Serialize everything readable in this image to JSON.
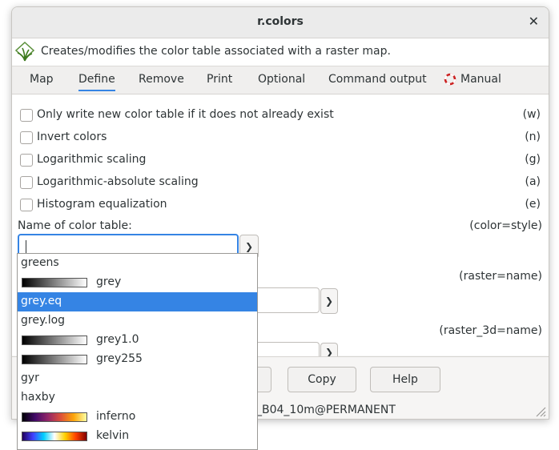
{
  "window": {
    "title": "r.colors"
  },
  "description": "Creates/modifies the color table associated with a raster map.",
  "tabs": [
    {
      "label": "Map"
    },
    {
      "label": "Define"
    },
    {
      "label": "Remove"
    },
    {
      "label": "Print"
    },
    {
      "label": "Optional"
    },
    {
      "label": "Command output"
    },
    {
      "label": "Manual"
    }
  ],
  "active_tab": "Define",
  "flags": [
    {
      "label": "Only write new color table if it does not already exist",
      "key": "(w)",
      "checked": false
    },
    {
      "label": "Invert colors",
      "key": "(n)",
      "checked": false
    },
    {
      "label": "Logarithmic scaling",
      "key": "(g)",
      "checked": false
    },
    {
      "label": "Logarithmic-absolute scaling",
      "key": "(a)",
      "checked": false
    },
    {
      "label": "Histogram equalization",
      "key": "(e)",
      "checked": false
    }
  ],
  "color_table": {
    "label": "Name of color table:",
    "key": "(color=style)",
    "value": ""
  },
  "raster": {
    "key": "(raster=name)"
  },
  "raster_3d": {
    "key": "(raster_3d=name)"
  },
  "buttons": {
    "copy": "Copy",
    "help": "Help"
  },
  "status_text": "_B04_10m@PERMANENT",
  "dropdown": {
    "items": [
      {
        "label": "greens",
        "swatch": null
      },
      {
        "label": "grey",
        "swatch": "linear-gradient(90deg,#000000,#ffffff)"
      },
      {
        "label": "grey.eq",
        "swatch": null,
        "selected": true
      },
      {
        "label": "grey.log",
        "swatch": null
      },
      {
        "label": "grey1.0",
        "swatch": "linear-gradient(90deg,#000000,#ffffff)"
      },
      {
        "label": "grey255",
        "swatch": "linear-gradient(90deg,#000000,#ffffff)"
      },
      {
        "label": "gyr",
        "swatch": null
      },
      {
        "label": "haxby",
        "swatch": null
      },
      {
        "label": "inferno",
        "swatch": "linear-gradient(90deg,#000004,#420a68,#932667,#dd513a,#fca50a,#fcffa4)"
      },
      {
        "label": "kelvin",
        "swatch": "linear-gradient(90deg,#20005c,#4040ff,#00d0ff,#ffffff,#ffd000,#ff4000,#800000)"
      }
    ]
  }
}
